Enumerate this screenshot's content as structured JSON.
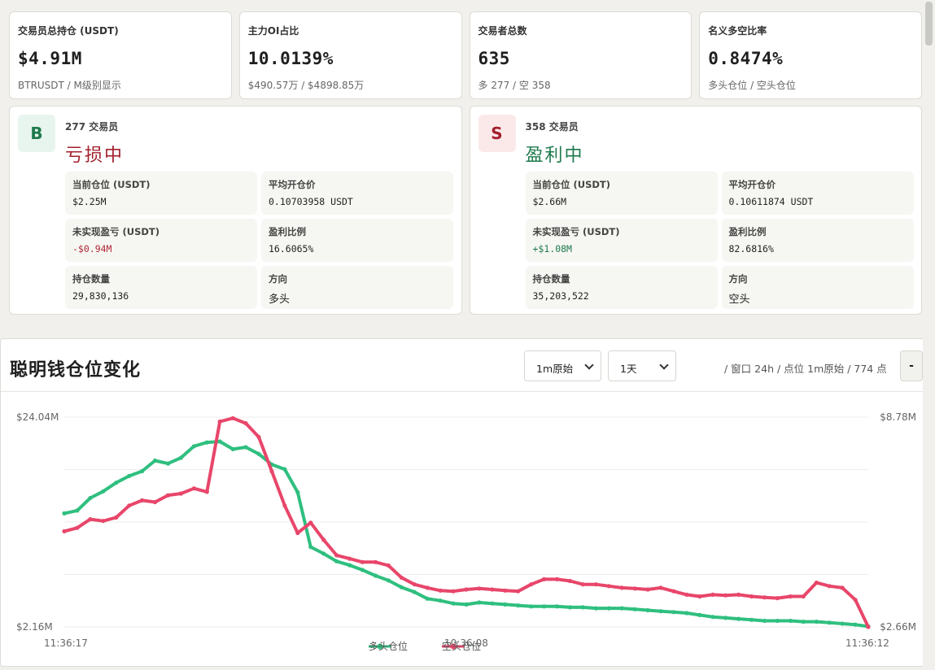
{
  "stats": [
    {
      "label": "交易员总持仓 (USDT)",
      "value": "$4.91M",
      "sub": "BTRUSDT / M级别显示"
    },
    {
      "label": "主力OI占比",
      "value": "10.0139%",
      "sub": "$490.57万 / $4898.85万"
    },
    {
      "label": "交易者总数",
      "value": "635",
      "sub": "多 277 / 空 358"
    },
    {
      "label": "名义多空比率",
      "value": "0.8474%",
      "sub": "多头仓位 / 空头仓位"
    }
  ],
  "long_side": {
    "badge": "B",
    "count": "277 交易员",
    "status": "亏损中",
    "cells": [
      {
        "label": "当前仓位 (USDT)",
        "value": "$2.25M"
      },
      {
        "label": "平均开仓价",
        "value": "0.10703958 USDT"
      },
      {
        "label": "未实现盈亏 (USDT)",
        "value": "-$0.94M"
      },
      {
        "label": "盈利比例",
        "value": "16.6065%"
      },
      {
        "label": "持仓数量",
        "value": "29,830,136"
      },
      {
        "label": "方向",
        "value": "多头"
      }
    ]
  },
  "short_side": {
    "badge": "S",
    "count": "358 交易员",
    "status": "盈利中",
    "cells": [
      {
        "label": "当前仓位 (USDT)",
        "value": "$2.66M"
      },
      {
        "label": "平均开仓价",
        "value": "0.10611874 USDT"
      },
      {
        "label": "未实现盈亏 (USDT)",
        "value": "+$1.08M"
      },
      {
        "label": "盈利比例",
        "value": "82.6816%"
      },
      {
        "label": "持仓数量",
        "value": "35,203,522"
      },
      {
        "label": "方向",
        "value": "空头"
      }
    ]
  },
  "chart_panel": {
    "title": "聪明钱仓位变化",
    "interval_select": "1m原始",
    "range_select": "1天",
    "meta": "/ 窗口 24h / 点位 1m原始 / 774 点",
    "dash_button": "-"
  },
  "colors": {
    "long": "#2fbf7f",
    "short": "#e8466a",
    "loss": "#a3202d",
    "profit": "#1e7a4c"
  },
  "chart_data": {
    "type": "line",
    "x_tick_labels": [
      "11:36:17",
      "10:36:08",
      "11:36:12"
    ],
    "left_axis_labels": [
      "$24.04M",
      "$2.16M"
    ],
    "right_axis_labels": [
      "$8.78M",
      "$2.66M"
    ],
    "grid": true,
    "legend": "bottom-center",
    "points_per_series": 774,
    "series": [
      {
        "name": "多头仓位",
        "axis": "left",
        "values_M": [
          14.0,
          14.3,
          15.6,
          16.3,
          17.2,
          17.9,
          18.4,
          19.5,
          19.2,
          19.8,
          21.0,
          21.4,
          21.5,
          20.7,
          20.9,
          20.2,
          19.1,
          18.6,
          16.2,
          10.5,
          9.8,
          9.0,
          8.6,
          8.1,
          7.5,
          7.0,
          6.3,
          5.8,
          5.1,
          4.9,
          4.6,
          4.5,
          4.7,
          4.6,
          4.5,
          4.4,
          4.3,
          4.3,
          4.3,
          4.2,
          4.2,
          4.1,
          4.1,
          4.1,
          4.0,
          3.9,
          3.8,
          3.7,
          3.6,
          3.4,
          3.2,
          3.1,
          3.0,
          2.9,
          2.8,
          2.8,
          2.8,
          2.7,
          2.7,
          2.6,
          2.5,
          2.4,
          2.2
        ]
      },
      {
        "name": "空头仓位",
        "axis": "right",
        "values_M": [
          5.45,
          5.55,
          5.8,
          5.75,
          5.85,
          6.2,
          6.35,
          6.3,
          6.5,
          6.55,
          6.7,
          6.6,
          8.65,
          8.75,
          8.6,
          8.2,
          7.2,
          6.2,
          5.4,
          5.7,
          5.2,
          4.75,
          4.65,
          4.55,
          4.55,
          4.45,
          4.1,
          3.9,
          3.8,
          3.72,
          3.7,
          3.75,
          3.78,
          3.75,
          3.72,
          3.7,
          3.9,
          4.05,
          4.05,
          4.0,
          3.9,
          3.9,
          3.85,
          3.8,
          3.78,
          3.75,
          3.8,
          3.7,
          3.6,
          3.55,
          3.6,
          3.58,
          3.6,
          3.55,
          3.52,
          3.5,
          3.55,
          3.55,
          3.95,
          3.85,
          3.8,
          3.45,
          2.66
        ]
      }
    ]
  }
}
